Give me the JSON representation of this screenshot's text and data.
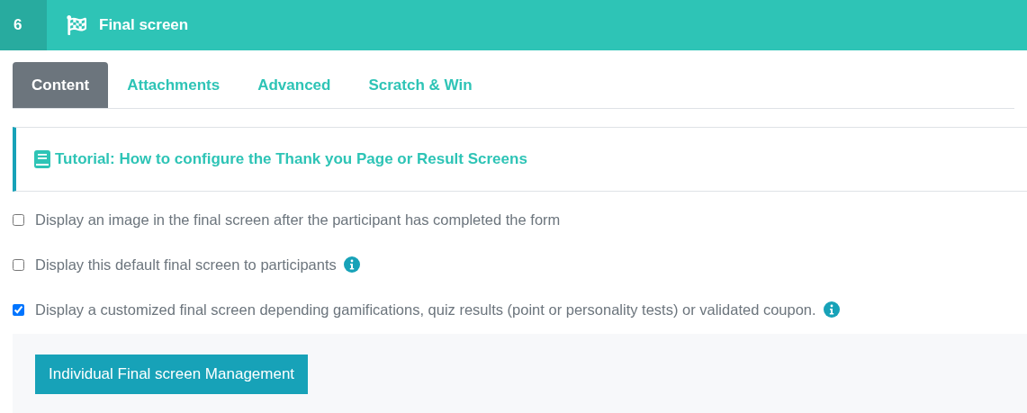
{
  "header": {
    "step": "6",
    "title": "Final screen"
  },
  "tabs": [
    {
      "label": "Content",
      "selected": true
    },
    {
      "label": "Attachments",
      "selected": false
    },
    {
      "label": "Advanced",
      "selected": false
    },
    {
      "label": "Scratch & Win",
      "selected": false
    }
  ],
  "tutorial_link": "Tutorial: How to configure the Thank you Page or Result Screens",
  "options": [
    {
      "label": "Display an image in the final screen after the participant has completed the form",
      "checked": false,
      "info": false
    },
    {
      "label": "Display this default final screen to participants",
      "checked": false,
      "info": true
    },
    {
      "label": "Display a customized final screen depending gamifications, quiz results (point or personality tests) or validated coupon.",
      "checked": true,
      "info": true
    }
  ],
  "button": "Individual Final screen Management"
}
